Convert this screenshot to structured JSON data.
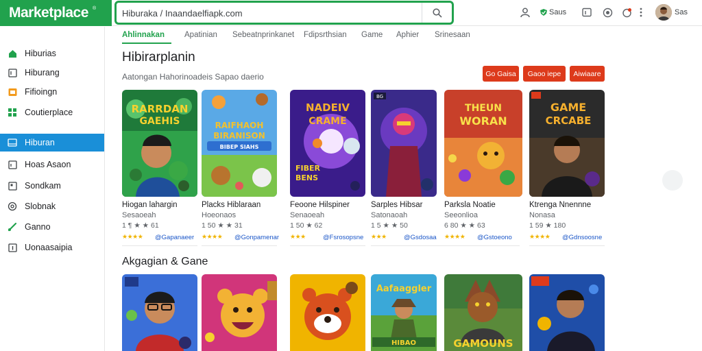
{
  "header": {
    "brand": "Marketplace",
    "brand_mark": "®",
    "search_value": "Hiburaka / Inaandaelfiapk.com",
    "status_text": "Saus",
    "user_name": "Sas"
  },
  "sidebar": {
    "items": [
      {
        "label": "Hiburias",
        "icon": "home-icon"
      },
      {
        "label": "Hiburang",
        "icon": "book-icon"
      },
      {
        "label": "Fifioingn",
        "icon": "folder-icon"
      },
      {
        "label": "Coutierplace",
        "icon": "grid-icon"
      },
      {
        "label": "Hiburan",
        "icon": "games-icon",
        "active": true
      },
      {
        "label": "Hoas Asaon",
        "icon": "document-icon"
      },
      {
        "label": "Sondkam",
        "icon": "bookmark-icon"
      },
      {
        "label": "Slobnak",
        "icon": "settings-icon"
      },
      {
        "label": "Ganno",
        "icon": "link-icon"
      },
      {
        "label": "Uonaasaipia",
        "icon": "info-icon"
      }
    ]
  },
  "tabs": [
    "Ahlinnakan",
    "Apatinian",
    "Sebeatnprinkanet",
    "Fdipsrthsian",
    "Game",
    "Aphier",
    "Srinesaan"
  ],
  "section1": {
    "title": "Hibirarplanin",
    "subtitle": "Aatongan Hahorinoadeis Sapao daerio",
    "buttons": [
      "Go Gaisa",
      "Gaoo iepe",
      "Aiwiaare"
    ]
  },
  "cards": [
    {
      "name": "Hiogan lahargin",
      "sub": "Sesaoeah",
      "meta": "1 ¶ ★ ★ 61",
      "stars": "★★★★",
      "dev": "@Gapanaeer",
      "art_title": [
        "RARRDAN",
        "GAEHIS"
      ],
      "accent": "#2fa24a"
    },
    {
      "name": "Placks Hiblaraan",
      "sub": "Hoeonaos",
      "meta": "1 50 ★ ★ 31",
      "stars": "★★★★",
      "dev": "@Gonpamenar",
      "art_title": [
        "RAIFHAOH",
        "BIRANISON",
        "BIBEP SIAHS"
      ],
      "accent": "#5aa9e6"
    },
    {
      "name": "Feoone Hilspiner",
      "sub": "Senaoeah",
      "meta": "1 50 ★ 62",
      "stars": "★★★",
      "dev": "@Fsrosopsne",
      "art_title": [
        "NADEIV",
        "CRAME",
        "FIBER",
        "BENS"
      ],
      "accent": "#6a3cc8"
    },
    {
      "name": "Sarples Hibsar",
      "sub": "Satonaoah",
      "meta": "1 5 ★ ★ 50",
      "stars": "★★★",
      "dev": "@Gsdosaa",
      "art_title": [
        "BG"
      ],
      "accent": "#3a2a8a"
    },
    {
      "name": "Parksla Noatie",
      "sub": "Seeonlioa",
      "meta": "6 80 ★ ★ 63",
      "stars": "★★★★",
      "dev": "@Gstoeono",
      "art_title": [
        "THEUN",
        "WORAN"
      ],
      "accent": "#d56030"
    },
    {
      "name": "Ktrenga Nnennne",
      "sub": "Nonasa",
      "meta": "1 59 ★ 180",
      "stars": "★★★★",
      "dev": "@Gdnsoosne",
      "art_title": [
        "GAME",
        "CRCABE"
      ],
      "accent": "#2b2b2b"
    }
  ],
  "section2": {
    "title": "Akgagian & Gane",
    "cards": [
      {
        "caption": "",
        "accent": "#3b6fd8"
      },
      {
        "caption": "",
        "accent": "#d1357a"
      },
      {
        "caption": "",
        "accent": "#f0b400"
      },
      {
        "caption": "HIBAO",
        "art_title": "Aafaaggler",
        "accent": "#3aa8d8"
      },
      {
        "caption": "GAMOUNS",
        "accent": "#3f7a3a"
      },
      {
        "caption": "",
        "accent": "#1f4ea8"
      }
    ]
  },
  "colors": {
    "brand_green": "#21a24d",
    "active_blue": "#1a8fd8",
    "button_red": "#dd3a1b",
    "link_blue": "#1a56c8",
    "star_gold": "#f0b400"
  }
}
